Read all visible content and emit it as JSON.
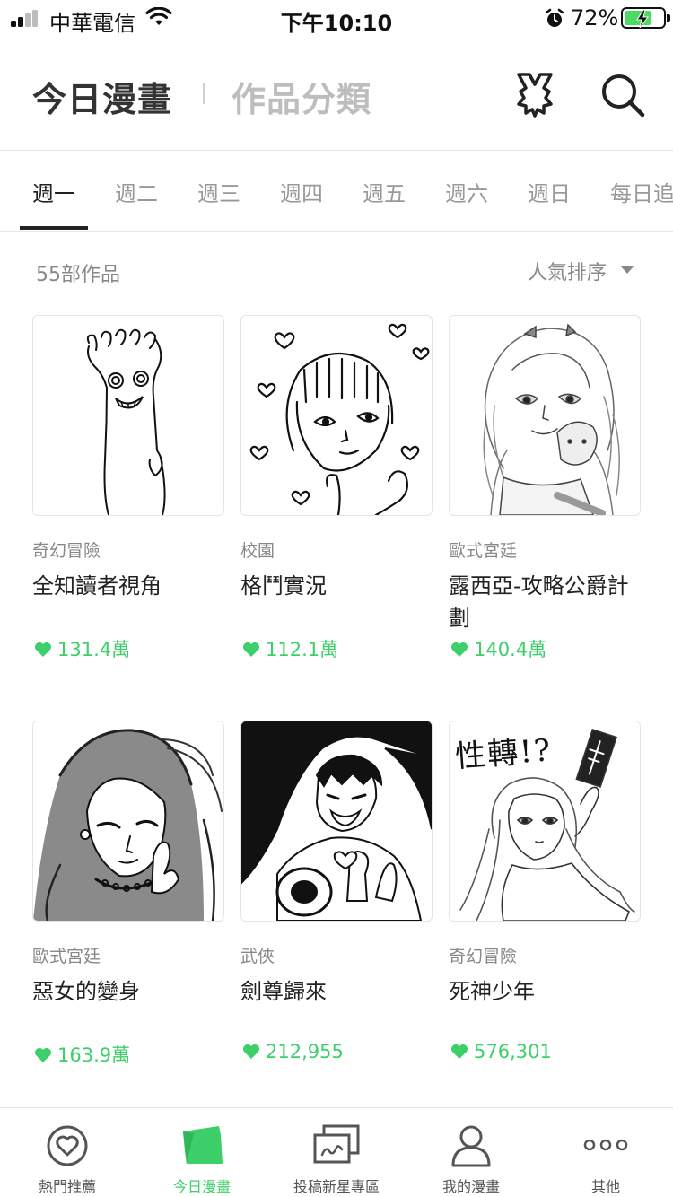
{
  "status_bar": {
    "carrier": "中華電信",
    "time": "下午10:10",
    "battery_percent": "72%",
    "battery_level": 0.72,
    "charging": true,
    "icons": [
      "signal-icon",
      "wifi-icon",
      "alarm-icon",
      "battery-icon"
    ]
  },
  "header": {
    "title": "今日漫畫",
    "secondary_title": "作品分類",
    "icons": [
      "badge-icon",
      "search-icon"
    ]
  },
  "tabs": [
    "週一",
    "週二",
    "週三",
    "週四",
    "週五",
    "週六",
    "週日",
    "每日追"
  ],
  "active_tab": 0,
  "list": {
    "count": "55部作品",
    "sort_label": "人氣排序"
  },
  "comics": [
    {
      "genre": "奇幻冒險",
      "title": "全知讀者視角",
      "likes": "131.4萬"
    },
    {
      "genre": "校園",
      "title": "格鬥實況",
      "likes": "112.1萬"
    },
    {
      "genre": "歐式宮廷",
      "title": "露西亞-攻略公爵計劃",
      "likes": "140.4萬"
    },
    {
      "genre": "歐式宮廷",
      "title": "惡女的變身",
      "likes": "163.9萬"
    },
    {
      "genre": "武俠",
      "title": "劍尊歸來",
      "likes": "212,955"
    },
    {
      "genre": "奇幻冒險",
      "title": "死神少年",
      "likes": "576,301"
    }
  ],
  "thumbnail_text": {
    "comic_6": "性轉!?"
  },
  "bottom_nav": [
    {
      "label": "熱門推薦",
      "icon": "heart-circle-icon"
    },
    {
      "label": "今日漫畫",
      "icon": "comic-book-icon"
    },
    {
      "label": "投稿新星專區",
      "icon": "submission-icon"
    },
    {
      "label": "我的漫畫",
      "icon": "user-icon"
    },
    {
      "label": "其他",
      "icon": "more-icon"
    }
  ],
  "colors": {
    "accent": "#3ccf6a",
    "text_primary": "#222222",
    "text_secondary": "#888888",
    "divider": "#e3e3e3"
  }
}
